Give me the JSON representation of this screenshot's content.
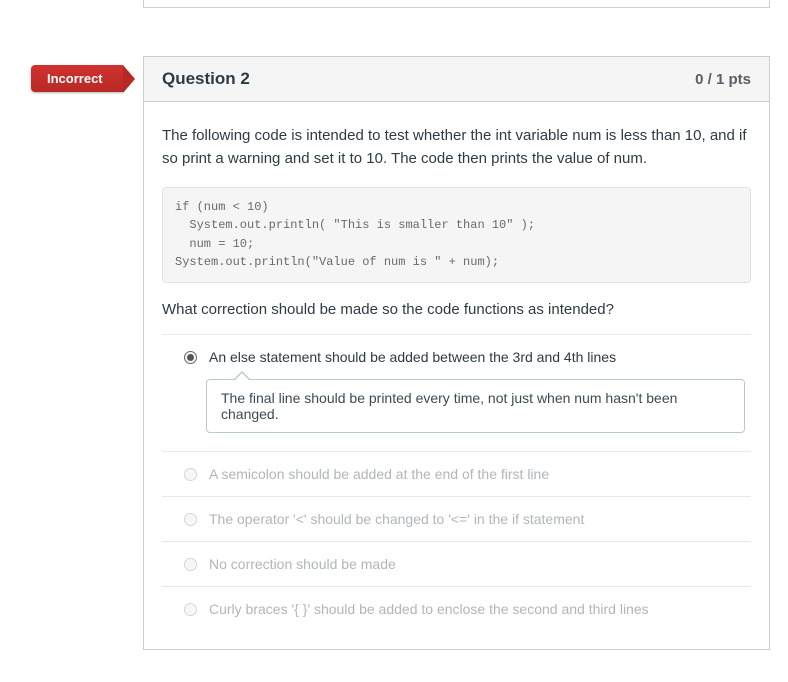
{
  "badge": {
    "label": "Incorrect"
  },
  "header": {
    "title": "Question 2",
    "points": "0 / 1 pts"
  },
  "prompt": {
    "intro": "The following code is intended to test whether the int variable num is less than 10, and if so print a warning and set it to 10. The code then prints the value of num.",
    "code": "if (num < 10)\n  System.out.println( \"This is smaller than 10\" );\n  num = 10;\nSystem.out.println(\"Value of num is \" + num);",
    "followup": "What correction should be made so the code functions as intended?"
  },
  "answers": [
    {
      "text": "An else statement should be added between the 3rd and 4th lines",
      "selected": true,
      "dim": false,
      "feedback": "The final line should be printed every time, not just when num hasn't been changed."
    },
    {
      "text": "A semicolon should be added at the end of the first line",
      "selected": false,
      "dim": true
    },
    {
      "text": "The operator '<' should be changed to '<=' in the if statement",
      "selected": false,
      "dim": true
    },
    {
      "text": "No correction should be made",
      "selected": false,
      "dim": true
    },
    {
      "text": "Curly braces '{ }' should be added to enclose the second and third lines",
      "selected": false,
      "dim": true
    }
  ]
}
